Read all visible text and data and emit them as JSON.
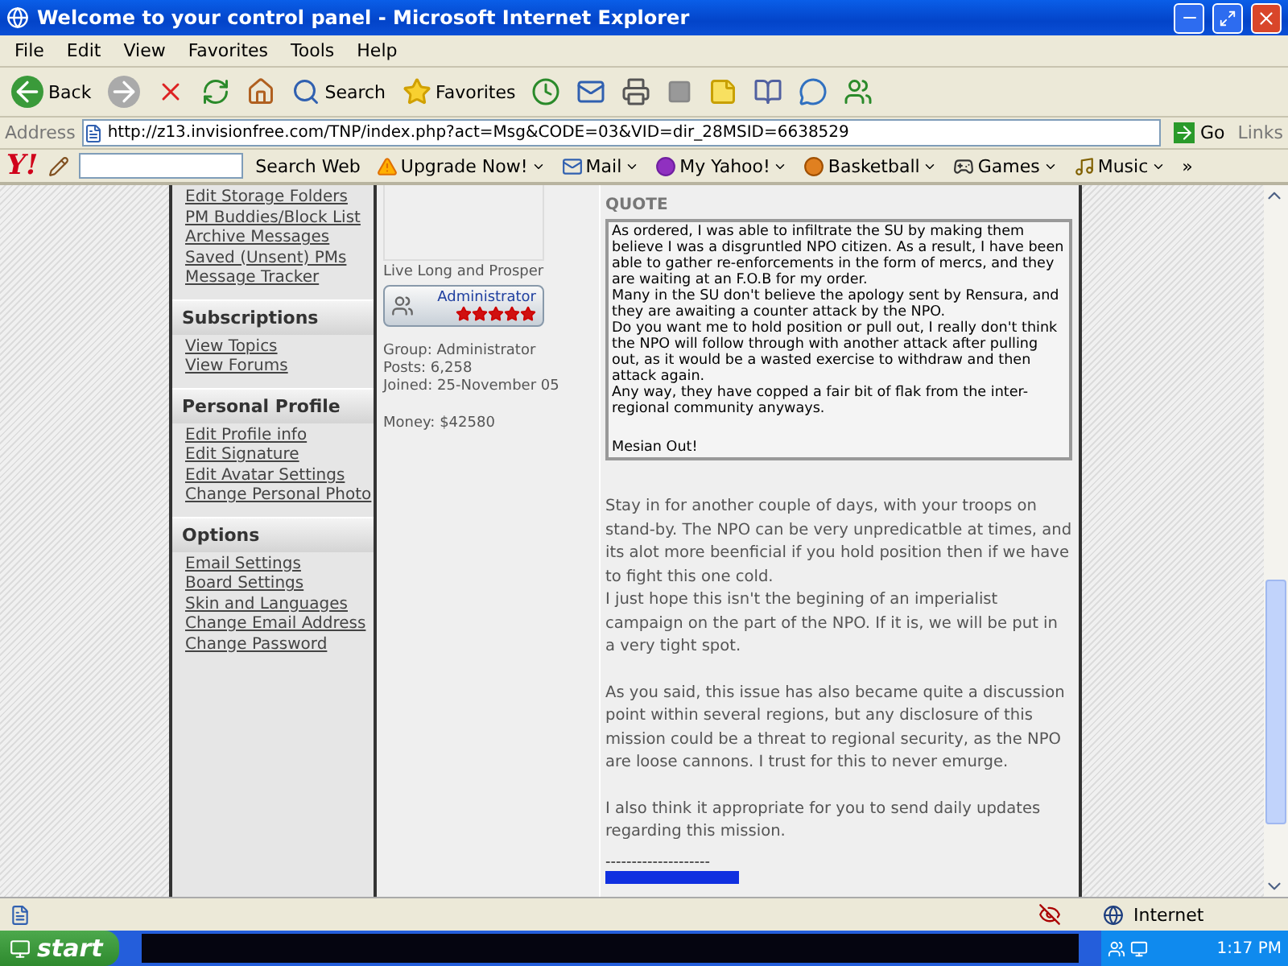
{
  "window": {
    "title": "Welcome to your control panel - Microsoft Internet Explorer"
  },
  "menu": [
    "File",
    "Edit",
    "View",
    "Favorites",
    "Tools",
    "Help"
  ],
  "toolbar": [
    {
      "kind": "back",
      "label": "Back"
    },
    {
      "kind": "forward"
    },
    {
      "kind": "stop"
    },
    {
      "kind": "refresh"
    },
    {
      "kind": "home"
    },
    {
      "kind": "search",
      "label": "Search"
    },
    {
      "kind": "favorites",
      "label": "Favorites"
    },
    {
      "kind": "history"
    },
    {
      "kind": "mail"
    },
    {
      "kind": "print"
    },
    {
      "kind": "edit"
    },
    {
      "kind": "note"
    },
    {
      "kind": "research"
    },
    {
      "kind": "chat"
    },
    {
      "kind": "contacts"
    }
  ],
  "address": {
    "label": "Address",
    "url": "http://z13.invisionfree.com/TNP/index.php?act=Msg&CODE=03&VID=dir_28MSID=6638529",
    "go": "Go",
    "links": "Links"
  },
  "yahoo_bar": {
    "logo": "Y!",
    "search_button": "Search Web",
    "items": [
      {
        "kind": "upgrade",
        "label": "Upgrade Now!"
      },
      {
        "kind": "mail",
        "label": "Mail"
      },
      {
        "kind": "myyahoo",
        "label": "My Yahoo!"
      },
      {
        "kind": "basketball",
        "label": "Basketball"
      },
      {
        "kind": "games",
        "label": "Games"
      },
      {
        "kind": "music",
        "label": "Music"
      }
    ],
    "more": "»"
  },
  "sidebar": [
    {
      "items": [
        "Edit Storage Folders",
        "PM Buddies/Block List",
        "Archive Messages",
        "Saved (Unsent) PMs",
        "Message Tracker"
      ]
    },
    {
      "title": "Subscriptions",
      "items": [
        "View Topics",
        "View Forums"
      ]
    },
    {
      "title": "Personal Profile",
      "items": [
        "Edit Profile info",
        "Edit Signature",
        "Edit Avatar Settings",
        "Change Personal Photo"
      ]
    },
    {
      "title": "Options",
      "items": [
        "Email Settings",
        "Board Settings",
        "Skin and Languages",
        "Change Email Address",
        "Change Password"
      ]
    }
  ],
  "author": {
    "motto": "Live Long and Prosper",
    "rank": "Administrator",
    "stars": 5,
    "details": [
      "Group: Administrator",
      "Posts: 6,258",
      "Joined: 25-November 05"
    ],
    "money": "Money: $42580"
  },
  "message": {
    "quote_label": "QUOTE",
    "quote": [
      [
        "As ordered, I was able to infiltrate the SU by making them believe I was a disgruntled NPO citizen. As a result, I have been able to gather re-enforcements in the form of mercs, and they are waiting at an F.O.B for my order.",
        "Many in the SU don't believe the apology sent by Rensura, and they are awaiting a counter attack by the NPO.",
        "Do you want me to hold position or pull out, I really don't think the NPO will follow through with another attack after pulling out, as it would be a wasted exercise to withdraw and then attack again.",
        "Any way, they have copped a fair bit of flak from the inter-regional community anyways."
      ],
      [
        "Mesian Out!"
      ]
    ],
    "reply": [
      [
        "Stay in for another couple of days, with your troops on stand-by. The NPO can be very unpredicatble at times, and its alot more beenficial if you hold position then if we have to fight this one cold.",
        "I just hope this isn't the begining of an imperialist campaign on the part of the NPO. If it is, we will be put in a very tight spot."
      ],
      [
        "As you said, this issue has also became quite a discussion point within several regions, but any disclosure of this mission could be a threat to regional security, as the NPO are loose cannons. I trust for this to never emurge."
      ],
      [
        "I also think it appropriate for you to send daily updates regarding this mission."
      ]
    ],
    "signature_rule": "--------------------"
  },
  "status_bar": {
    "zone": "Internet"
  },
  "taskbar": {
    "start": "start",
    "time": "1:17 PM"
  }
}
